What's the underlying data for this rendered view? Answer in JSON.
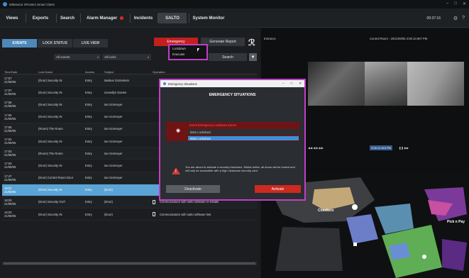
{
  "app": {
    "title": "Milestone XProtect Smart Client",
    "clock": "09:37:16",
    "setup_label": "Setup"
  },
  "nav": {
    "tabs": [
      "Views",
      "Exports",
      "Search",
      "Alarm Manager",
      "Incidents",
      "SALTO",
      "System Monitor"
    ]
  },
  "salto": {
    "subtabs": [
      "EVENTS",
      "LOCK STATUS",
      "LIVE VIEW"
    ],
    "emergency_label": "Emergency",
    "generate_label": "Generate Report",
    "emergency_menu": [
      "Lockdown",
      "Evacuate"
    ],
    "filters": {
      "events": "All events",
      "locks": "All locks"
    },
    "search_label": "Search",
    "columns": [
      "Time/Date",
      "Lock Name",
      "Access",
      "Subject",
      "Operation"
    ],
    "rows": [
      {
        "time": "17:57",
        "date": "21/08/05",
        "lock": "(Door) Security IN",
        "access": "Entry",
        "subject": "Markus Gotzestein",
        "op": ""
      },
      {
        "time": "17:57",
        "date": "21/08/05",
        "lock": "(Door) Security IN",
        "access": "Entry",
        "subject": "Llewellyn Davies",
        "op": ""
      },
      {
        "time": "17:56",
        "date": "21/08/05",
        "lock": "(Door) Security IN",
        "access": "Entry",
        "subject": "Ian Gormeyer",
        "op": ""
      },
      {
        "time": "17:55",
        "date": "21/08/05",
        "lock": "(Door) Security IN",
        "access": "Entry",
        "subject": "Ian Gormeyer",
        "op": ""
      },
      {
        "time": "17:55",
        "date": "21/08/05",
        "lock": "(Room) The Room",
        "access": "Entry",
        "subject": "Ian Gormeyer",
        "op": ""
      },
      {
        "time": "17:54",
        "date": "21/08/05",
        "lock": "(Door) Security IN",
        "access": "Entry",
        "subject": "Ian Gormeyer",
        "op": ""
      },
      {
        "time": "17:53",
        "date": "21/08/05",
        "lock": "(Room) The Room",
        "access": "Entry",
        "subject": "Ian Gormeyer",
        "op": ""
      },
      {
        "time": "17:53",
        "date": "21/08/05",
        "lock": "(Door) Security IN",
        "access": "Entry",
        "subject": "Ian Gormeyer",
        "op": ""
      },
      {
        "time": "17:47",
        "date": "21/08/05",
        "lock": "(Door) Control Room Door",
        "access": "Entry",
        "subject": "Ian Gormeyer",
        "op": ""
      },
      {
        "time": "18:02",
        "date": "21/08/05",
        "lock": "(Door) Security IN",
        "access": "Entry",
        "subject": "(Door)",
        "op": ""
      },
      {
        "time": "18:03",
        "date": "21/08/05",
        "lock": "(Door) Security OUT",
        "access": "Entry",
        "subject": "(Door)",
        "op": "Communication with salto software re-establi"
      },
      {
        "time": "18:03",
        "date": "21/08/05",
        "lock": "(Door) Security IN",
        "access": "Entry",
        "subject": "(Door)",
        "op": "Communication with salto software lost"
      }
    ],
    "selected_row": 9
  },
  "cameras": {
    "left_label": "Entrance",
    "right_label": "Control Room - 2021/08/05 3:05:10.907 PM",
    "timestamp": "3:05:11.343 PM",
    "map_labels": [
      "Checkers",
      "Pick n Pay"
    ]
  },
  "modal": {
    "window_title": "Emergency Situations",
    "heading": "EMERGENCY SITUATIONS",
    "section_title": "Event Emergency Lockdown Zones",
    "select_value": "Main Lockdown",
    "option_value": "Main Lockdown",
    "warning": "You are about to activate a security lockdown. Whilst active, all doors will be locked and will only be accessible with a high clearance security card.",
    "deactivate_label": "Deactivate",
    "activate_label": "Activate"
  },
  "colors": {
    "accent_blue": "#4e88b9",
    "selected_row": "#5aa4d6",
    "emergency_red": "#c21f1f",
    "highlight_magenta": "#c43ec7"
  }
}
